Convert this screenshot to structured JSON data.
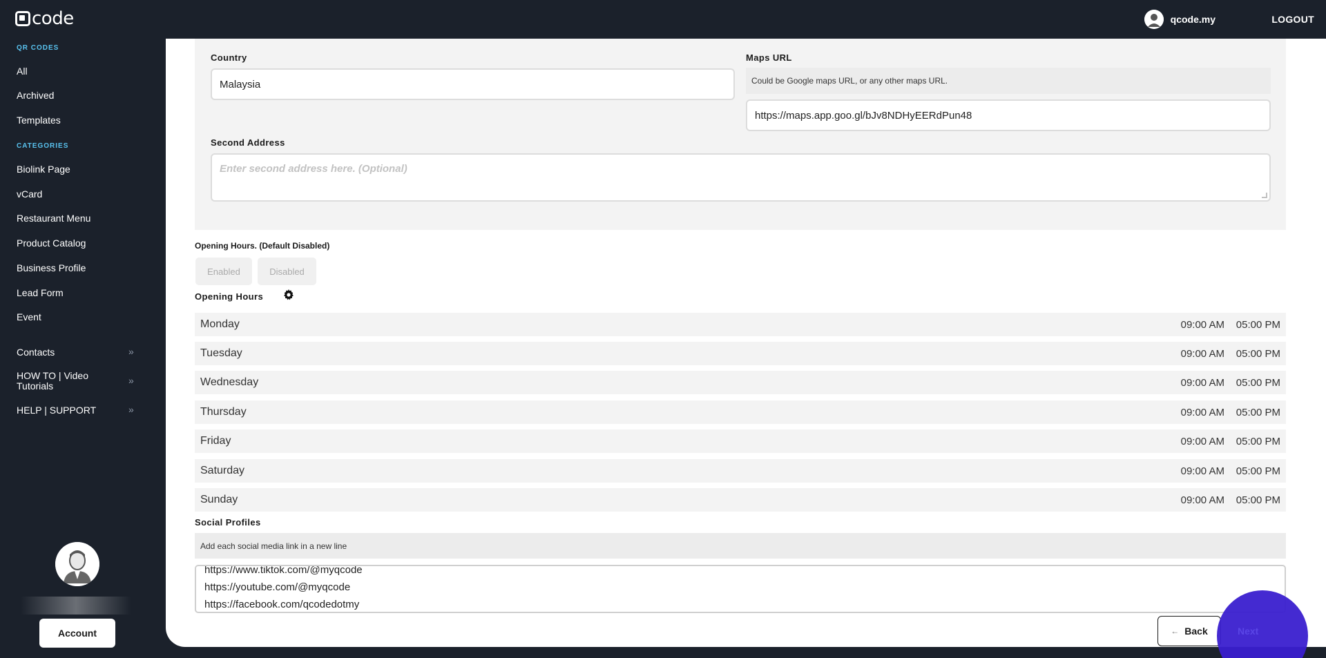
{
  "topbar": {
    "logo_text": "code",
    "user_name": "qcode.my",
    "logout_label": "LOGOUT"
  },
  "sidebar": {
    "qr_codes_label": "QR CODES",
    "qr_items": [
      "All",
      "Archived",
      "Templates"
    ],
    "categories_label": "CATEGORIES",
    "category_items": [
      "Biolink Page",
      "vCard",
      "Restaurant Menu",
      "Product Catalog",
      "Business Profile",
      "Lead Form",
      "Event"
    ],
    "extra_items": [
      "Contacts",
      "HOW TO | Video Tutorials",
      "HELP | SUPPORT"
    ],
    "account_label": "Account"
  },
  "form": {
    "country_label": "Country",
    "country_value": "Malaysia",
    "maps_label": "Maps URL",
    "maps_hint": "Could be Google maps URL, or any other maps URL.",
    "maps_value": "https://maps.app.goo.gl/bJv8NDHyEERdPun48",
    "second_address_label": "Second Address",
    "second_address_placeholder": "Enter second address here. (Optional)",
    "opening_hours_toggle_label": "Opening Hours. (Default Disabled)",
    "enabled_label": "Enabled",
    "disabled_label": "Disabled",
    "opening_hours_title": "Opening Hours",
    "days": [
      {
        "day": "Monday",
        "open": "09:00 AM",
        "close": "05:00 PM"
      },
      {
        "day": "Tuesday",
        "open": "09:00 AM",
        "close": "05:00 PM"
      },
      {
        "day": "Wednesday",
        "open": "09:00 AM",
        "close": "05:00 PM"
      },
      {
        "day": "Thursday",
        "open": "09:00 AM",
        "close": "05:00 PM"
      },
      {
        "day": "Friday",
        "open": "09:00 AM",
        "close": "05:00 PM"
      },
      {
        "day": "Saturday",
        "open": "09:00 AM",
        "close": "05:00 PM"
      },
      {
        "day": "Sunday",
        "open": "09:00 AM",
        "close": "05:00 PM"
      }
    ],
    "social_title": "Social Profiles",
    "social_hint": "Add each social media link in a new line",
    "social_links": [
      "https://www.tiktok.com/@myqcode",
      "https://youtube.com/@myqcode",
      "https://facebook.com/qcodedotmy"
    ],
    "back_label": "Back",
    "next_label": "Next"
  },
  "colors": {
    "sidebar_bg": "#1b212b",
    "section_label": "#59c3f0",
    "accent_purple": "#3a1fcf"
  }
}
